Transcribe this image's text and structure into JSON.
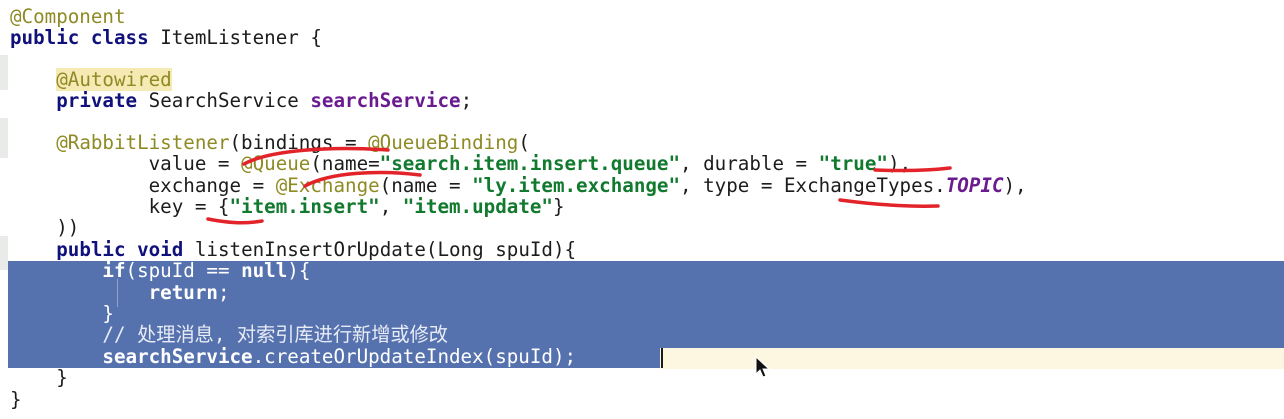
{
  "editor": {
    "colors": {
      "selection": "#5672ae",
      "caret_line": "#fdf7e2",
      "keyword": "#11117c",
      "annotation": "#8e8a24",
      "string": "#127a2e",
      "field": "#6a1b8f",
      "red_marks": "#e2232a"
    },
    "lines": {
      "l1": "@Component",
      "l2_kw1": "public",
      "l2_kw2": "class",
      "l2_rest": " ItemListener {",
      "l4_ann": "@Autowired",
      "l5_kw": "private",
      "l5_type": " SearchService ",
      "l5_field": "searchService",
      "l5_end": ";",
      "l7_ann1": "@RabbitListener",
      "l7_mid": "(bindings = ",
      "l7_ann2": "@QueueBinding",
      "l7_end": "(",
      "l8_a": "value = ",
      "l8_ann": "@Queue",
      "l8_b": "(name=",
      "l8_str1": "\"search.item.insert.queue\"",
      "l8_c": ", durable = ",
      "l8_str2": "\"true\"",
      "l8_d": "),",
      "l9_a": "exchange = ",
      "l9_ann": "@Exchange",
      "l9_b": "(name = ",
      "l9_str": "\"ly.item.exchange\"",
      "l9_c": ", type = ExchangeTypes.",
      "l9_const": "TOPIC",
      "l9_d": "),",
      "l10_a": "key = {",
      "l10_str1": "\"item.insert\"",
      "l10_b": ", ",
      "l10_str2": "\"item.update\"",
      "l10_c": "}",
      "l11": "))",
      "l12_kw1": "public",
      "l12_kw2": "void",
      "l12_rest": " listenInsertOrUpdate(Long spuId){",
      "l13_kw": "if",
      "l13_a": "(spuId == ",
      "l13_kw2": "null",
      "l13_b": "){",
      "l14_kw": "return",
      "l14_b": ";",
      "l15": "}",
      "l16": "// 处理消息, 对索引库进行新增或修改",
      "l17_field": "searchService",
      "l17_rest": ".createOrUpdateIndex(spuId);",
      "l18": "}",
      "l19": "}"
    }
  }
}
